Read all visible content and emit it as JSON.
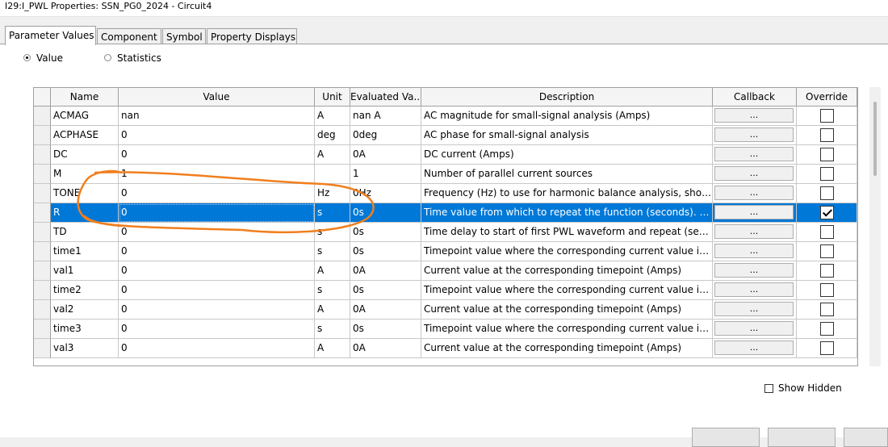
{
  "window": {
    "title": "I29:I_PWL Properties: SSN_PG0_2024 - Circuit4"
  },
  "tabs": [
    {
      "label": "Parameter Values",
      "active": true
    },
    {
      "label": "Component",
      "active": false
    },
    {
      "label": "Symbol",
      "active": false
    },
    {
      "label": "Property Displays",
      "active": false
    }
  ],
  "mode": {
    "value_label": "Value",
    "statistics_label": "Statistics",
    "selected": "Value"
  },
  "grid": {
    "columns": [
      "Name",
      "Value",
      "Unit",
      "Evaluated Va...",
      "Description",
      "Callback",
      "Override"
    ],
    "selected_row": 5,
    "rows": [
      {
        "name": "ACMAG",
        "value": "nan",
        "unit": "A",
        "evaluated": "nan A",
        "description": "AC magnitude for small-signal analysis (Amps)",
        "callback": "...",
        "override": false
      },
      {
        "name": "ACPHASE",
        "value": "0",
        "unit": "deg",
        "evaluated": "0deg",
        "description": "AC phase for small-signal analysis",
        "callback": "...",
        "override": false
      },
      {
        "name": "DC",
        "value": "0",
        "unit": "A",
        "evaluated": "0A",
        "description": "DC current (Amps)",
        "callback": "...",
        "override": false
      },
      {
        "name": "M",
        "value": "1",
        "unit": "",
        "evaluated": "1",
        "description": "Number of parallel current sources",
        "callback": "...",
        "override": false
      },
      {
        "name": "TONE",
        "value": "0",
        "unit": "Hz",
        "evaluated": "0Hz",
        "description": "Frequency (Hz) to use for harmonic balance analysis, shoul...",
        "callback": "...",
        "override": false
      },
      {
        "name": "R",
        "value": "0",
        "unit": "s",
        "evaluated": "0s",
        "description": "Time value from which to repeat the function (seconds). Mu...",
        "callback": "...",
        "override": true
      },
      {
        "name": "TD",
        "value": "0",
        "unit": "s",
        "evaluated": "0s",
        "description": "Time delay to start of first PWL waveform and repeat (seco...",
        "callback": "...",
        "override": false
      },
      {
        "name": "time1",
        "value": "0",
        "unit": "s",
        "evaluated": "0s",
        "description": "Timepoint value where the corresponding current value is v...",
        "callback": "...",
        "override": false
      },
      {
        "name": "val1",
        "value": "0",
        "unit": "A",
        "evaluated": "0A",
        "description": "Current value at the corresponding timepoint (Amps)",
        "callback": "...",
        "override": false
      },
      {
        "name": "time2",
        "value": "0",
        "unit": "s",
        "evaluated": "0s",
        "description": "Timepoint value where the corresponding current value is v...",
        "callback": "...",
        "override": false
      },
      {
        "name": "val2",
        "value": "0",
        "unit": "A",
        "evaluated": "0A",
        "description": "Current value at the corresponding timepoint (Amps)",
        "callback": "...",
        "override": false
      },
      {
        "name": "time3",
        "value": "0",
        "unit": "s",
        "evaluated": "0s",
        "description": "Timepoint value where the corresponding current value is v...",
        "callback": "...",
        "override": false
      },
      {
        "name": "val3",
        "value": "0",
        "unit": "A",
        "evaluated": "0A",
        "description": "Current value at the corresponding timepoint (Amps)",
        "callback": "...",
        "override": false
      }
    ]
  },
  "show_hidden": {
    "label": "Show Hidden",
    "checked": false
  },
  "colors": {
    "selection": "#0078d7",
    "annotation": "#f07f1e"
  }
}
